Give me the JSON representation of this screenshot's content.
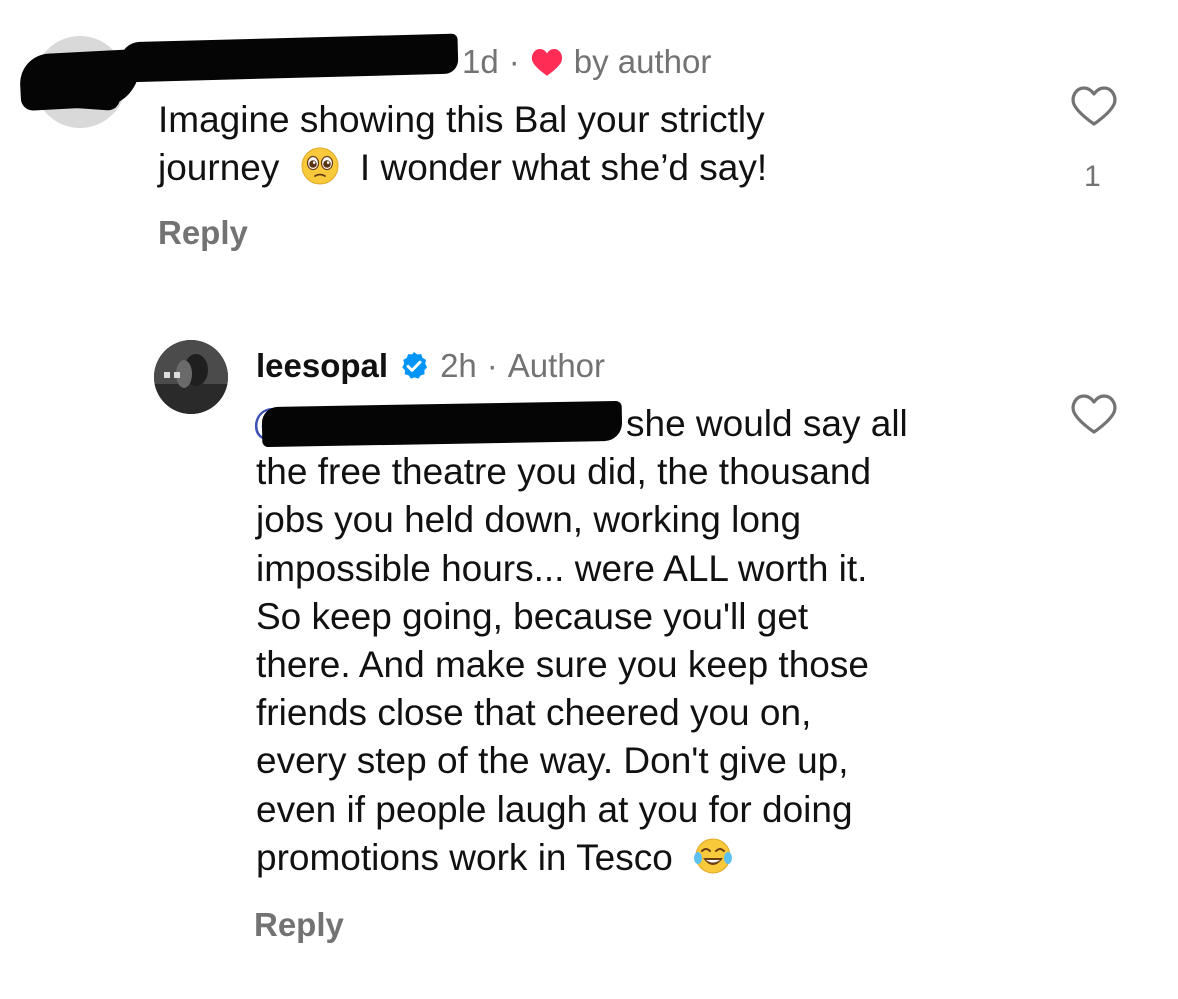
{
  "comment1": {
    "timestamp": "1d",
    "separator": "·",
    "liked_by": "by author",
    "text_line1": "Imagine showing this Bal your strictly",
    "text_line2a": "journey",
    "text_line2b": "I wonder what she’d say!",
    "emoji": "pleading-face",
    "reply_label": "Reply",
    "like_count": "1"
  },
  "comment2": {
    "username": "leesopal",
    "timestamp": "2h",
    "separator": "·",
    "role": "Author",
    "mention_prefix": "@",
    "text_first": "she would say all",
    "text_lines": [
      "the free theatre you did, the thousand",
      "jobs you held down, working long",
      "impossible hours... were ALL worth it.",
      "So keep going, because you'll get",
      "there. And make sure you keep those",
      "friends close that cheered you on,",
      "every step of the way. Don't give up,",
      "even if people laugh at you for doing",
      "promotions work in Tesco"
    ],
    "emoji": "face-with-tears-of-joy",
    "reply_label": "Reply"
  },
  "colors": {
    "text": "#111111",
    "muted": "#737373",
    "heart_red": "#ff2d55",
    "verified_blue": "#0095f6",
    "mention": "#3f51b5"
  }
}
